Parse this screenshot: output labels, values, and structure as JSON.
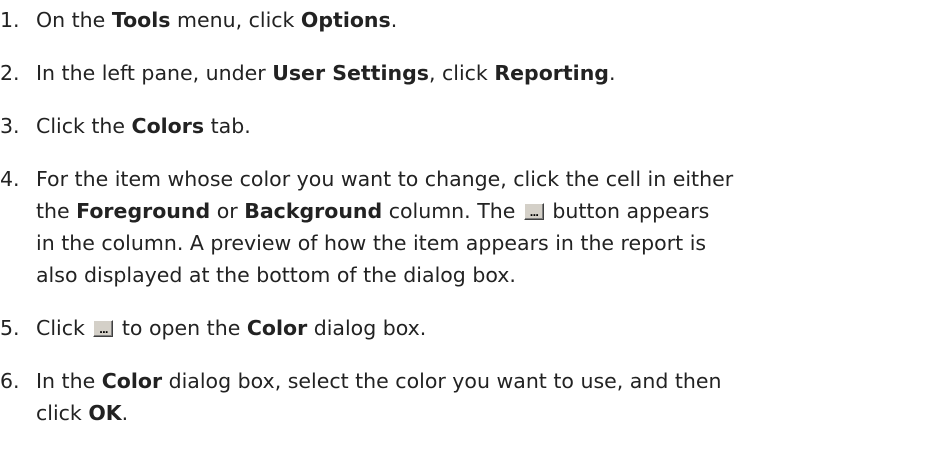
{
  "steps": [
    {
      "num": "1.",
      "t1": "On the ",
      "b1": "Tools",
      "t2": " menu, click ",
      "b2": "Options",
      "t3": "."
    },
    {
      "num": "2.",
      "t1": "In the left pane, under ",
      "b1": "User Settings",
      "t2": ", click ",
      "b2": "Reporting",
      "t3": "."
    },
    {
      "num": "3.",
      "t1": "Click the ",
      "b1": "Colors",
      "t2": " tab."
    },
    {
      "num": "4.",
      "line1_t1": "For the item whose color you want to change, click the cell in either",
      "line2_t1": "the ",
      "line2_b1": "Foreground",
      "line2_t2": " or ",
      "line2_b2": "Background",
      "line2_t3": " column. The ",
      "line2_t4": " button appears",
      "line3": "in the column. A preview of how the item appears in the report is",
      "line4": "also displayed at the bottom of the dialog box."
    },
    {
      "num": "5.",
      "t1": "Click ",
      "t2": " to open the ",
      "b1": "Color",
      "t3": " dialog box."
    },
    {
      "num": "6.",
      "line1_t1": "In the ",
      "line1_b1": "Color",
      "line1_t2": " dialog box, select the color you want to use, and then",
      "line2_t1": "click ",
      "line2_b1": "OK",
      "line2_t2": "."
    }
  ],
  "ellipsis_button_label": "..."
}
